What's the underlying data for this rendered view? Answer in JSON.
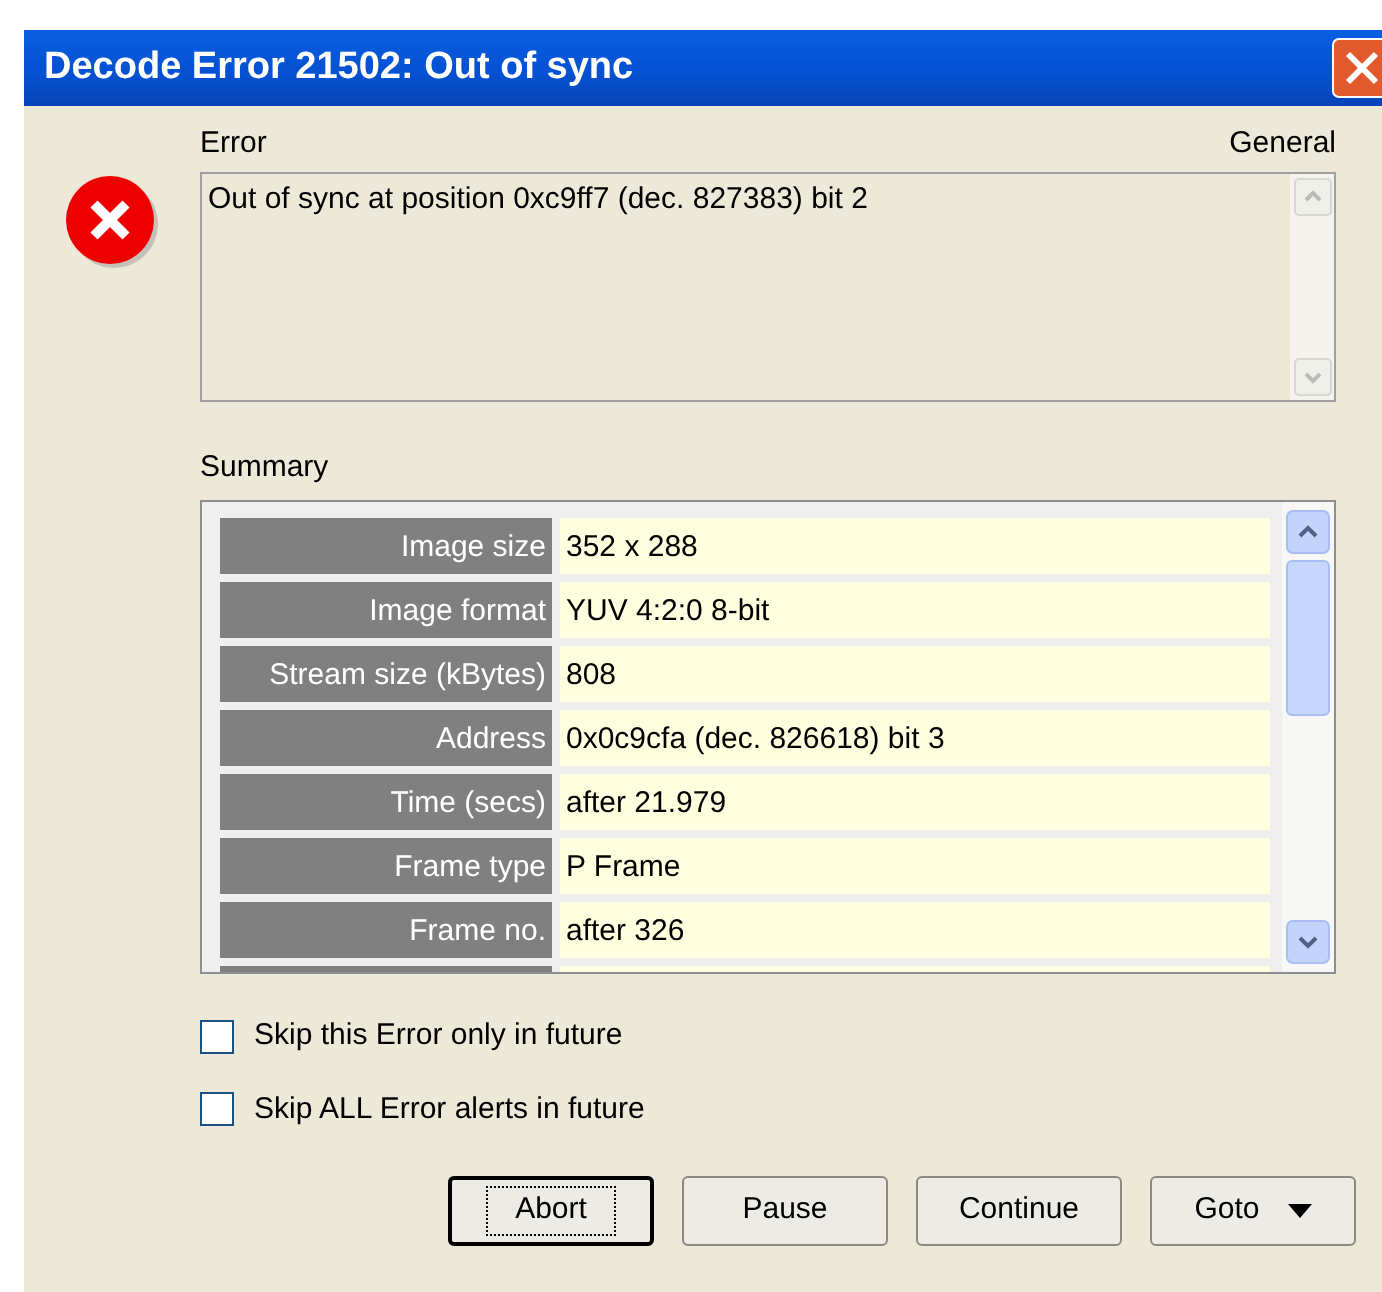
{
  "window": {
    "title": "Decode Error 21502: Out of sync"
  },
  "error": {
    "label": "Error",
    "category": "General",
    "message": "Out of sync at position 0xc9ff7 (dec. 827383) bit 2"
  },
  "summary": {
    "label": "Summary",
    "rows": [
      {
        "label": "Image size",
        "value": "352 x 288"
      },
      {
        "label": "Image format",
        "value": "YUV 4:2:0 8-bit"
      },
      {
        "label": "Stream size (kBytes)",
        "value": "808"
      },
      {
        "label": "Address",
        "value": "0x0c9cfa (dec. 826618) bit 3"
      },
      {
        "label": "Time (secs)",
        "value": "after 21.979"
      },
      {
        "label": "Frame type",
        "value": "P Frame"
      },
      {
        "label": "Frame no.",
        "value": "after 326"
      }
    ]
  },
  "options": [
    {
      "label": "Skip this Error only in future",
      "checked": false
    },
    {
      "label": "Skip ALL Error alerts in future",
      "checked": false
    }
  ],
  "buttons": [
    {
      "label": "Abort",
      "focused": true,
      "dropdown": false
    },
    {
      "label": "Pause",
      "focused": false,
      "dropdown": false
    },
    {
      "label": "Continue",
      "focused": false,
      "dropdown": false
    },
    {
      "label": "Goto",
      "focused": false,
      "dropdown": true
    }
  ]
}
